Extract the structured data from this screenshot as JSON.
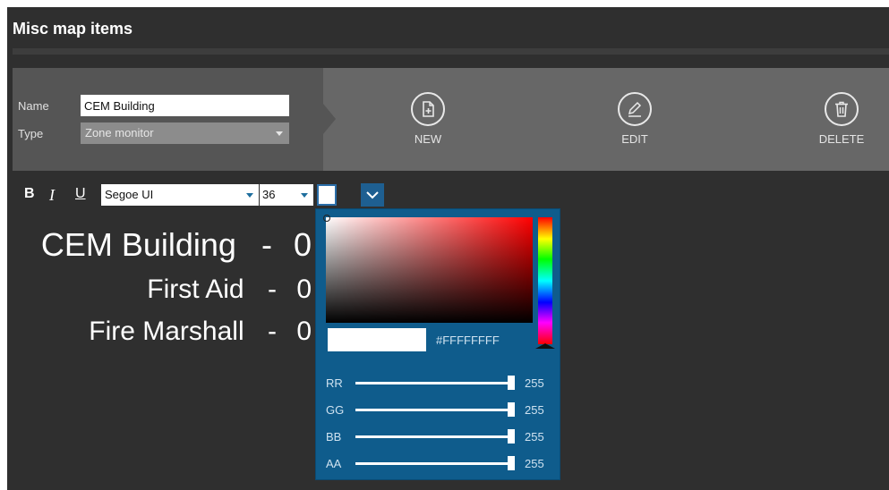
{
  "header": {
    "title": "Misc map items"
  },
  "form": {
    "name_label": "Name",
    "name_value": "CEM Building",
    "type_label": "Type",
    "type_value": "Zone monitor"
  },
  "toolbar": {
    "new_label": "NEW",
    "edit_label": "EDIT",
    "delete_label": "DELETE",
    "icons": [
      "new-document-icon",
      "edit-pencil-icon",
      "trash-icon"
    ]
  },
  "format": {
    "bold": "B",
    "italic": "I",
    "underline": "U",
    "font": "Segoe UI",
    "size": "36"
  },
  "preview": {
    "lines": [
      {
        "label": "CEM Building",
        "sep": "-",
        "value": "0"
      },
      {
        "label": "First Aid",
        "sep": "-",
        "value": "0"
      },
      {
        "label": "Fire Marshall",
        "sep": "-",
        "value": "0"
      }
    ]
  },
  "color_picker": {
    "hex": "#FFFFFFFF",
    "current_color": "#ffffff",
    "hue_color": "#ff0000",
    "channels": [
      {
        "label": "RR",
        "value": "255"
      },
      {
        "label": "GG",
        "value": "255"
      },
      {
        "label": "BB",
        "value": "255"
      },
      {
        "label": "AA",
        "value": "255"
      }
    ]
  },
  "colors": {
    "background": "#2f2f2f",
    "form_panel": "#555555",
    "toolbar": "#676767",
    "accent": "#0f5c8c"
  }
}
